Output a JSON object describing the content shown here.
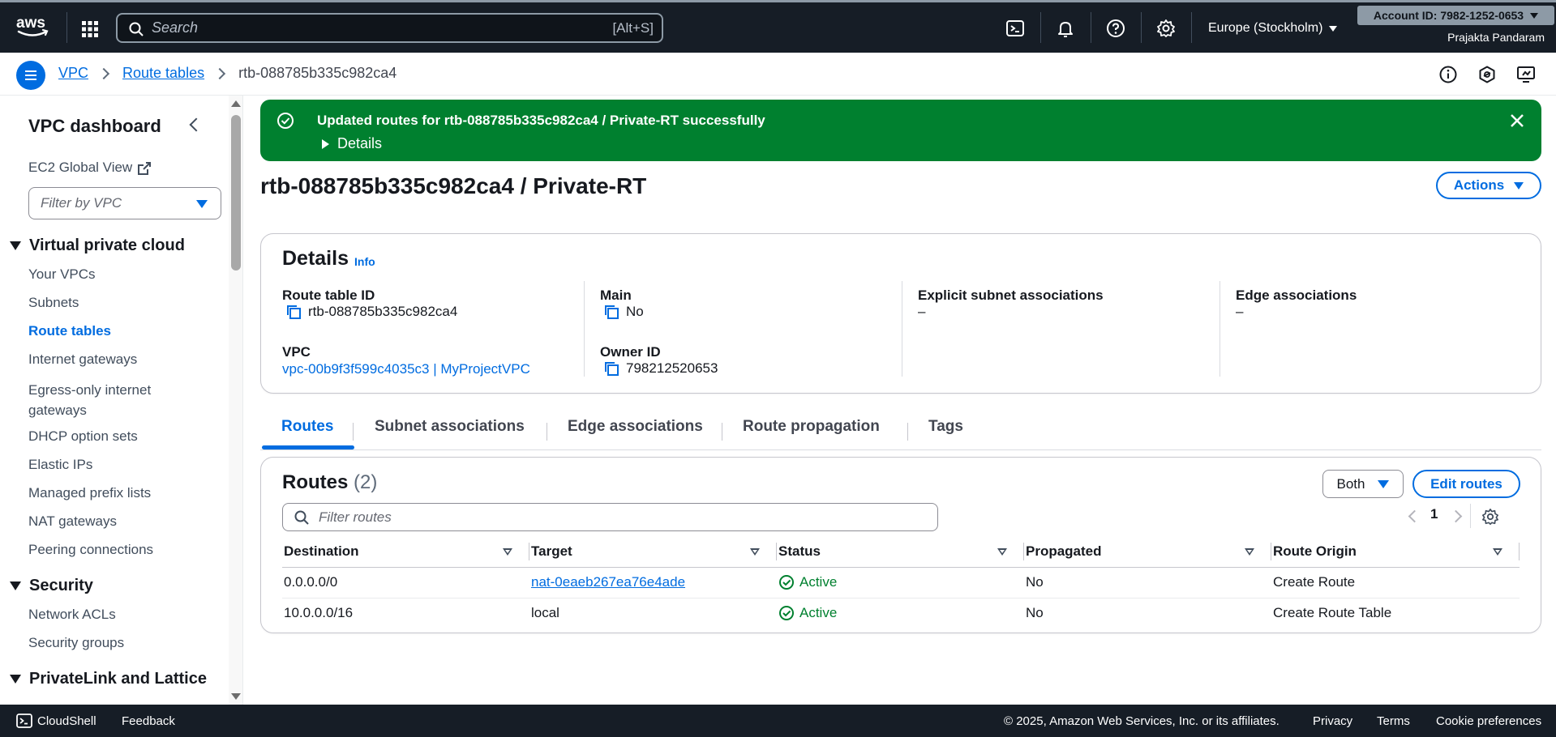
{
  "topnav": {
    "search_placeholder": "Search",
    "search_shortcut": "[Alt+S]",
    "region": "Europe (Stockholm)",
    "account": "Account ID: 7982-1252-0653",
    "user": "Prajakta Pandaram",
    "icons": [
      "aws-logo",
      "services-grid-icon",
      "search-icon",
      "cloudshell-icon",
      "bell-icon",
      "help-icon",
      "gear-icon"
    ]
  },
  "breadcrumb": {
    "items": [
      "VPC",
      "Route tables"
    ],
    "current": "rtb-088785b335c982ca4"
  },
  "sidebar": {
    "title": "VPC dashboard",
    "ec2_global_view": "EC2 Global View",
    "filter_placeholder": "Filter by VPC",
    "sections": [
      {
        "label": "Virtual private cloud",
        "items": [
          "Your VPCs",
          "Subnets",
          "Route tables",
          "Internet gateways",
          "Egress-only internet gateways",
          "DHCP option sets",
          "Elastic IPs",
          "Managed prefix lists",
          "NAT gateways",
          "Peering connections"
        ]
      },
      {
        "label": "Security",
        "items": [
          "Network ACLs",
          "Security groups"
        ]
      },
      {
        "label": "PrivateLink and Lattice",
        "items": []
      }
    ],
    "active_item": "Route tables"
  },
  "flash": {
    "message": "Updated routes for rtb-088785b335c982ca4 / Private-RT successfully",
    "details_label": "Details",
    "color": "#00802f"
  },
  "page": {
    "title": "rtb-088785b335c982ca4 / Private-RT",
    "actions_label": "Actions"
  },
  "details": {
    "heading": "Details",
    "info_label": "Info",
    "route_table_id_label": "Route table ID",
    "route_table_id": "rtb-088785b335c982ca4",
    "vpc_label": "VPC",
    "vpc": "vpc-00b9f3f599c4035c3 | MyProjectVPC",
    "main_label": "Main",
    "main": "No",
    "owner_id_label": "Owner ID",
    "owner_id": "798212520653",
    "explicit_subnet_label": "Explicit subnet associations",
    "explicit_subnet": "–",
    "edge_assoc_label": "Edge associations",
    "edge_assoc": "–"
  },
  "tabs": [
    "Routes",
    "Subnet associations",
    "Edge associations",
    "Route propagation",
    "Tags"
  ],
  "routes": {
    "heading": "Routes",
    "count": "(2)",
    "both_label": "Both",
    "edit_label": "Edit routes",
    "filter_placeholder": "Filter routes",
    "page": "1",
    "columns": [
      "Destination",
      "Target",
      "Status",
      "Propagated",
      "Route Origin"
    ],
    "rows": [
      {
        "destination": "0.0.0.0/0",
        "target": "nat-0eaeb267ea76e4ade",
        "status": "Active",
        "propagated": "No",
        "origin": "Create Route"
      },
      {
        "destination": "10.0.0.0/16",
        "target": "local",
        "status": "Active",
        "propagated": "No",
        "origin": "Create Route Table"
      }
    ]
  },
  "footer": {
    "cloudshell": "CloudShell",
    "feedback": "Feedback",
    "copyright": "© 2025, Amazon Web Services, Inc. or its affiliates.",
    "privacy": "Privacy",
    "terms": "Terms",
    "cookies": "Cookie preferences"
  }
}
